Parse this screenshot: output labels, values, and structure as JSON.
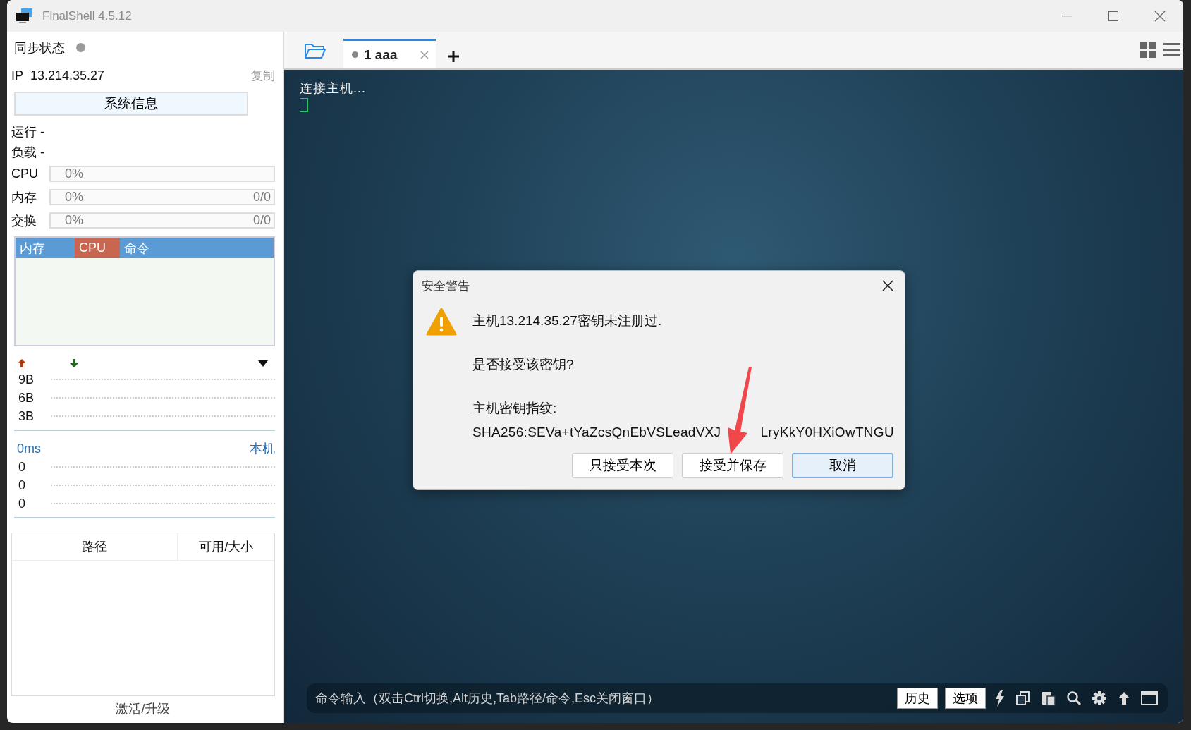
{
  "window": {
    "title": "FinalShell 4.5.12"
  },
  "sidebar": {
    "sync_label": "同步状态",
    "synced": false,
    "ip_label": "IP",
    "ip": "13.214.35.27",
    "copy_link": "复制",
    "sysinfo_button": "系统信息",
    "stats": [
      "运行 -",
      "负载 -"
    ],
    "meters": [
      {
        "label": "CPU",
        "reading": "0%",
        "level": 0
      },
      {
        "label": "内存",
        "reading": "0%",
        "detail": "0/0",
        "level": 0
      },
      {
        "label": "交换",
        "reading": "0%",
        "detail": "0/0",
        "level": 0
      }
    ],
    "process_table": {
      "columns": [
        {
          "label": "内存",
          "selected": false
        },
        {
          "label": "CPU",
          "selected": true
        },
        {
          "label": "命令",
          "selected": false
        }
      ]
    },
    "network": {
      "ticks": [
        "9B",
        "6B",
        "3B"
      ]
    },
    "latency": {
      "reading": "0ms",
      "host": "本机",
      "ticks": [
        "0",
        "0",
        "0"
      ]
    },
    "disk_table": {
      "columns": [
        "路径",
        "可用/大小"
      ]
    },
    "activate_link": "激活/升级"
  },
  "tabs": [
    {
      "label": "1 aaa",
      "selected": true
    }
  ],
  "terminal": {
    "lines": [
      "连接主机..."
    ]
  },
  "dialog": {
    "title": "安全警告",
    "message": "主机13.214.35.27密钥未注册过.",
    "question": "是否接受该密钥?",
    "fingerprint_label": "主机密钥指纹:",
    "fingerprint_start": "SHA256:SEVa+tYaZcsQnEbVSLeadVXJ",
    "fingerprint_end": "LryKkY0HXiOwTNGU",
    "buttons": [
      {
        "label": "只接受本次",
        "selected": false
      },
      {
        "label": "接受并保存",
        "selected": false
      },
      {
        "label": "取消",
        "selected": true
      }
    ]
  },
  "command_bar": {
    "placeholder": "命令输入（双击Ctrl切换,Alt历史,Tab路径/命令,Esc关闭窗口）",
    "buttons": [
      "历史",
      "选项"
    ]
  }
}
